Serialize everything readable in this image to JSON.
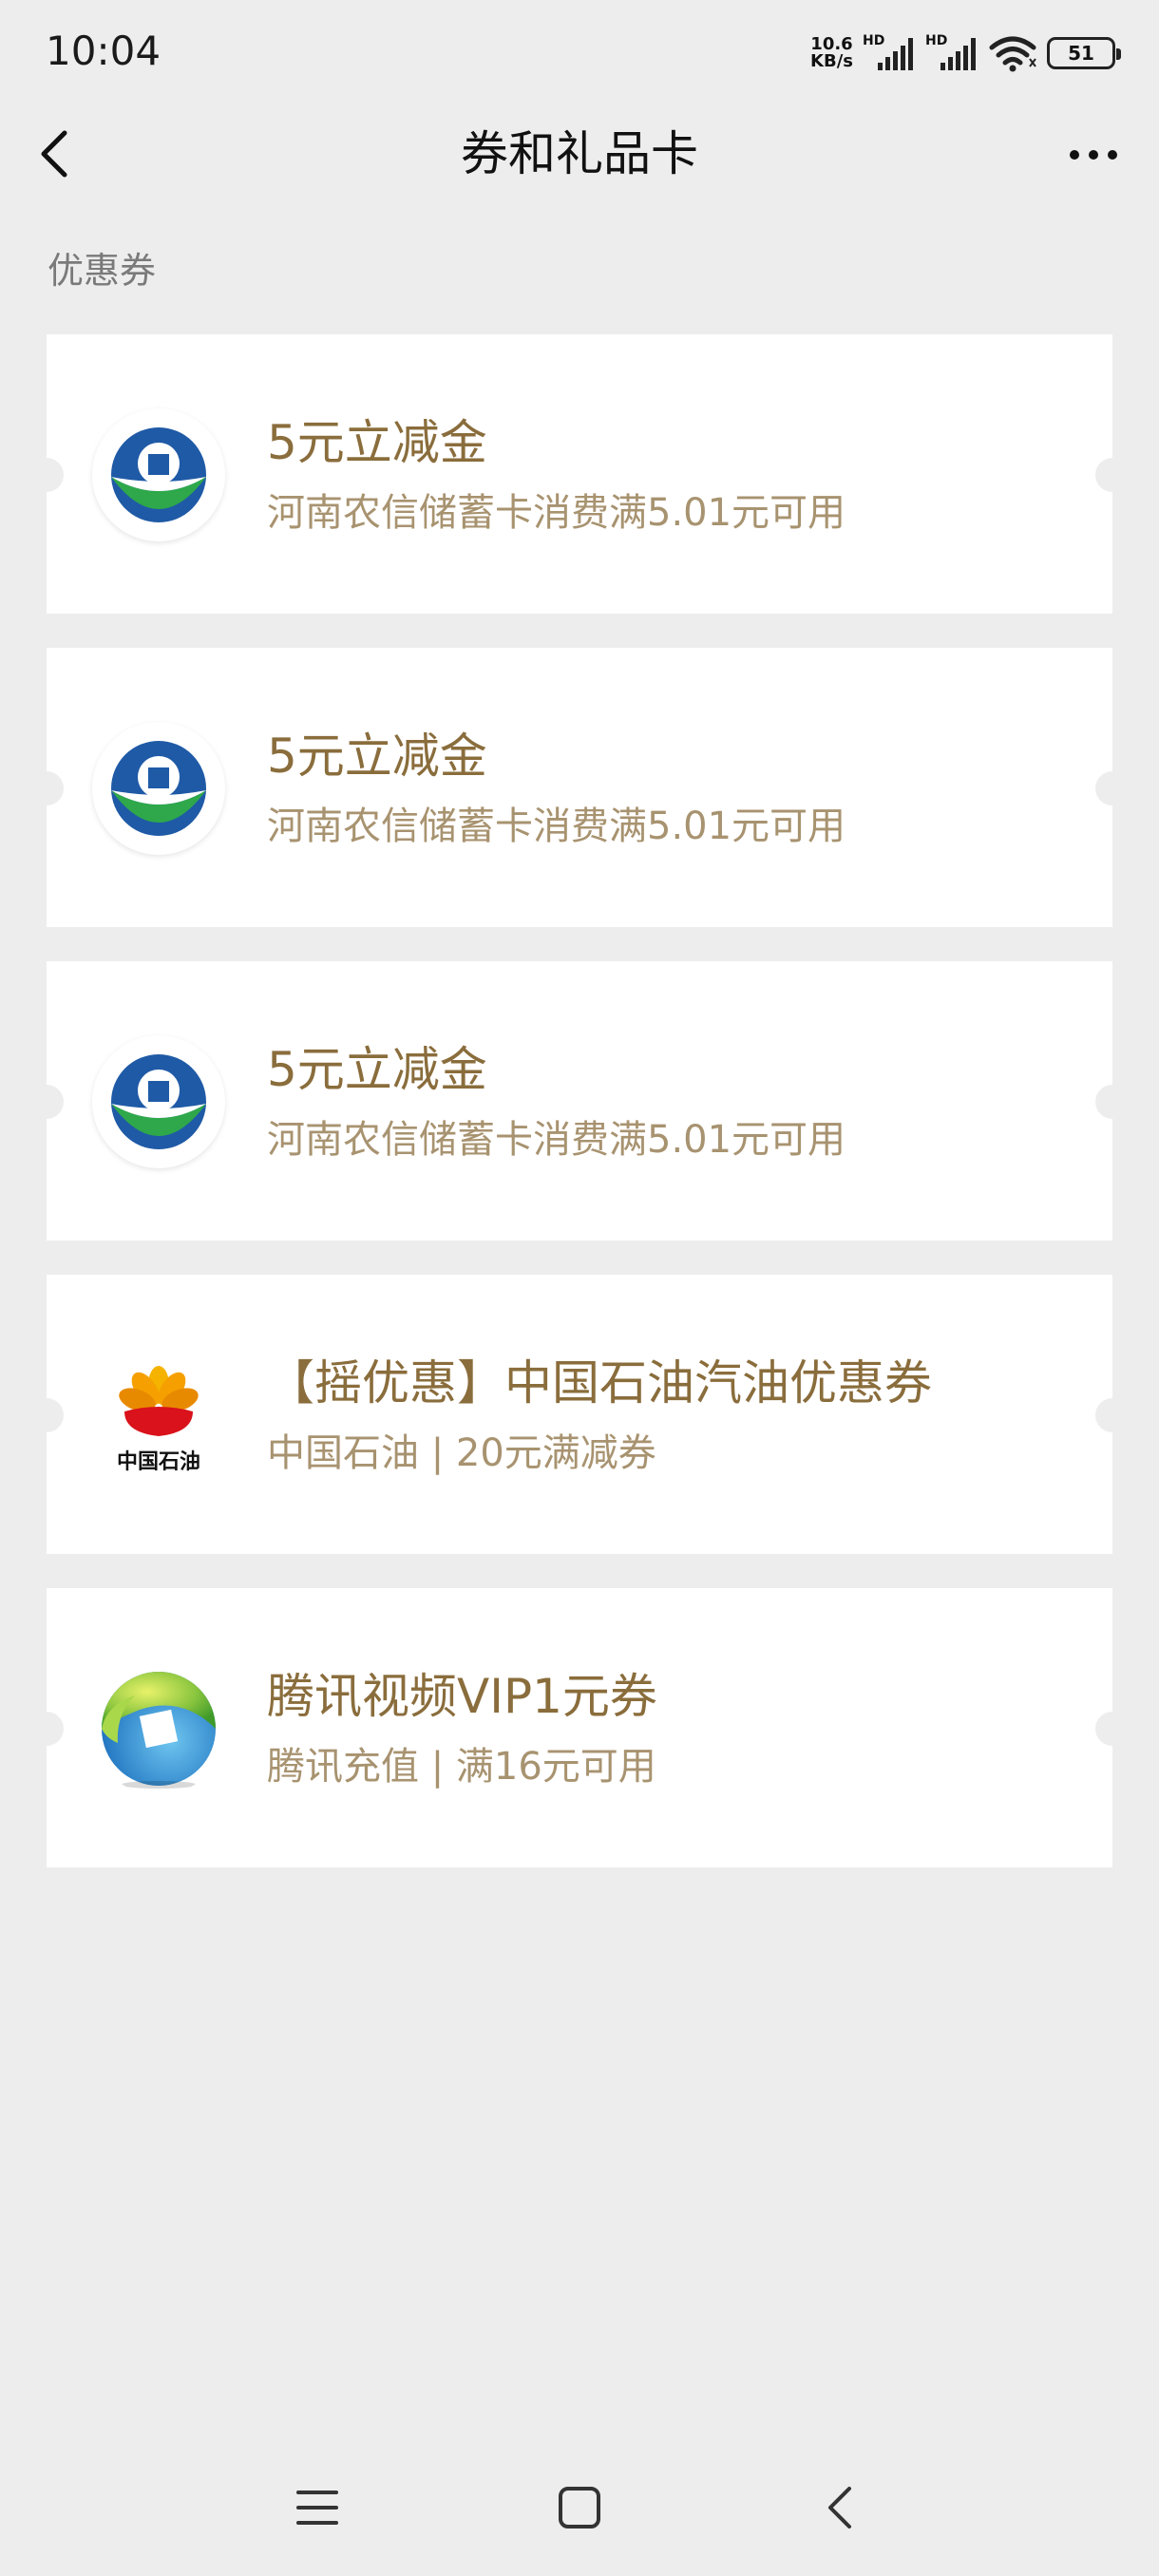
{
  "status_bar": {
    "time": "10:04",
    "net_speed_value": "10.6",
    "net_speed_unit": "KB/s",
    "sig1_label": "HD",
    "sig2_label": "HD",
    "battery": "51"
  },
  "header": {
    "title": "券和礼品卡"
  },
  "section": {
    "label": "优惠券"
  },
  "coupons": [
    {
      "title": "5元立减金",
      "subtitle": "河南农信储蓄卡消费满5.01元可用",
      "logo": "henan-rural-credit-logo"
    },
    {
      "title": "5元立减金",
      "subtitle": "河南农信储蓄卡消费满5.01元可用",
      "logo": "henan-rural-credit-logo"
    },
    {
      "title": "5元立减金",
      "subtitle": "河南农信储蓄卡消费满5.01元可用",
      "logo": "henan-rural-credit-logo"
    },
    {
      "title": "【摇优惠】中国石油汽油优惠券",
      "subtitle": "中国石油 | 20元满减券",
      "logo": "petrochina-logo",
      "logo_text": "中国石油"
    },
    {
      "title": "腾讯视频VIP1元券",
      "subtitle": "腾讯充值 | 满16元可用",
      "logo": "tencent-recharge-logo"
    }
  ],
  "colors": {
    "background": "#ededed",
    "coupon_title": "#8a6d3c",
    "coupon_subtitle": "#a89370"
  }
}
